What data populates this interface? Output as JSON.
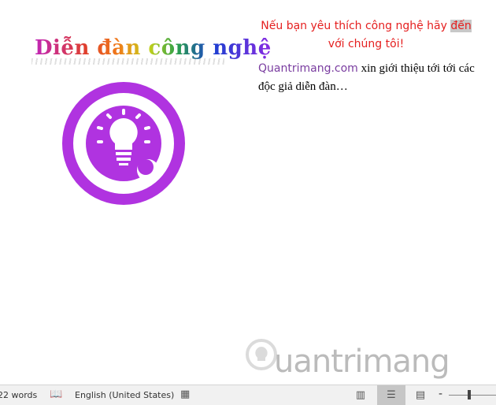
{
  "document": {
    "wordart": "Diễn đàn công nghệ",
    "red_text_before": "Nếu bạn yêu thích công nghệ hãy ",
    "red_text_highlight": "đến",
    "red_text_after": " với chúng tôi!",
    "intro_brand": "Quantrimang.com",
    "intro_text": " xin giới thiệu tới tới các độc giả diễn đàn…",
    "logo_color": "#b033e0",
    "watermark": "uantrimang"
  },
  "status_bar": {
    "word_count": "22 words",
    "language": "English (United States)",
    "views": [
      "read-mode",
      "print-layout",
      "web-layout"
    ],
    "active_view": "print-layout",
    "zoom_percent": 100
  }
}
